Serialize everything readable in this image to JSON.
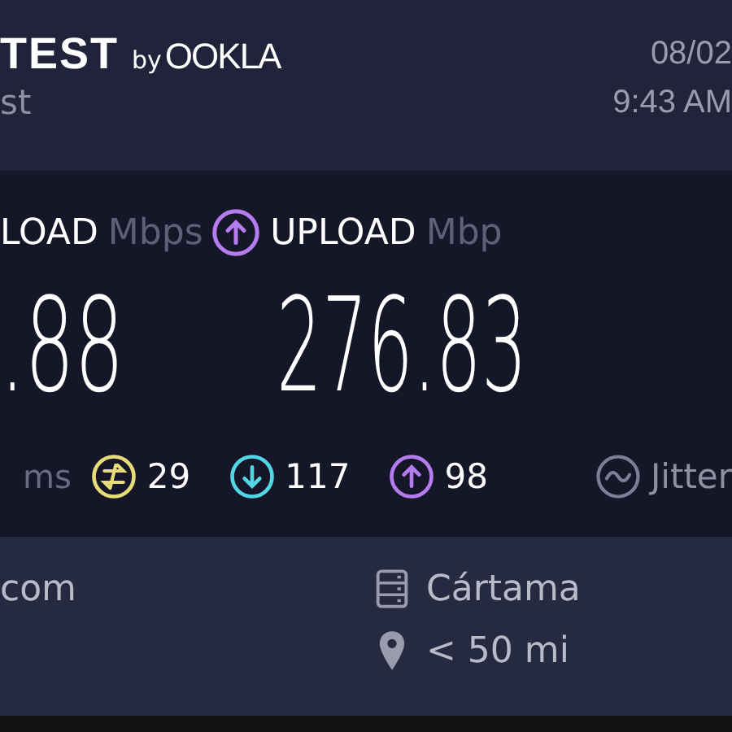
{
  "header": {
    "logo": "TEST",
    "byline": "by",
    "brand": "OOKLA",
    "subtitle": "st",
    "date": "08/02",
    "time": "9:43 AM"
  },
  "results": [
    {
      "kind": "download",
      "label": "LOAD",
      "unit": "Mbps",
      "value": ".88"
    },
    {
      "kind": "upload",
      "label": "UPLOAD",
      "unit": "Mbp",
      "value": "276.83"
    }
  ],
  "latency": {
    "ping_unit": "ms",
    "items": [
      {
        "kind": "idle",
        "value": "29",
        "color": "#e6dc78"
      },
      {
        "kind": "down",
        "value": "117",
        "color": "#52d6e4"
      },
      {
        "kind": "up",
        "value": "98",
        "color": "#b57cf0"
      }
    ],
    "jitter_label": "Jitter"
  },
  "connection": {
    "provider": "com",
    "server": "Cártama",
    "distance": "< 50 mi"
  }
}
